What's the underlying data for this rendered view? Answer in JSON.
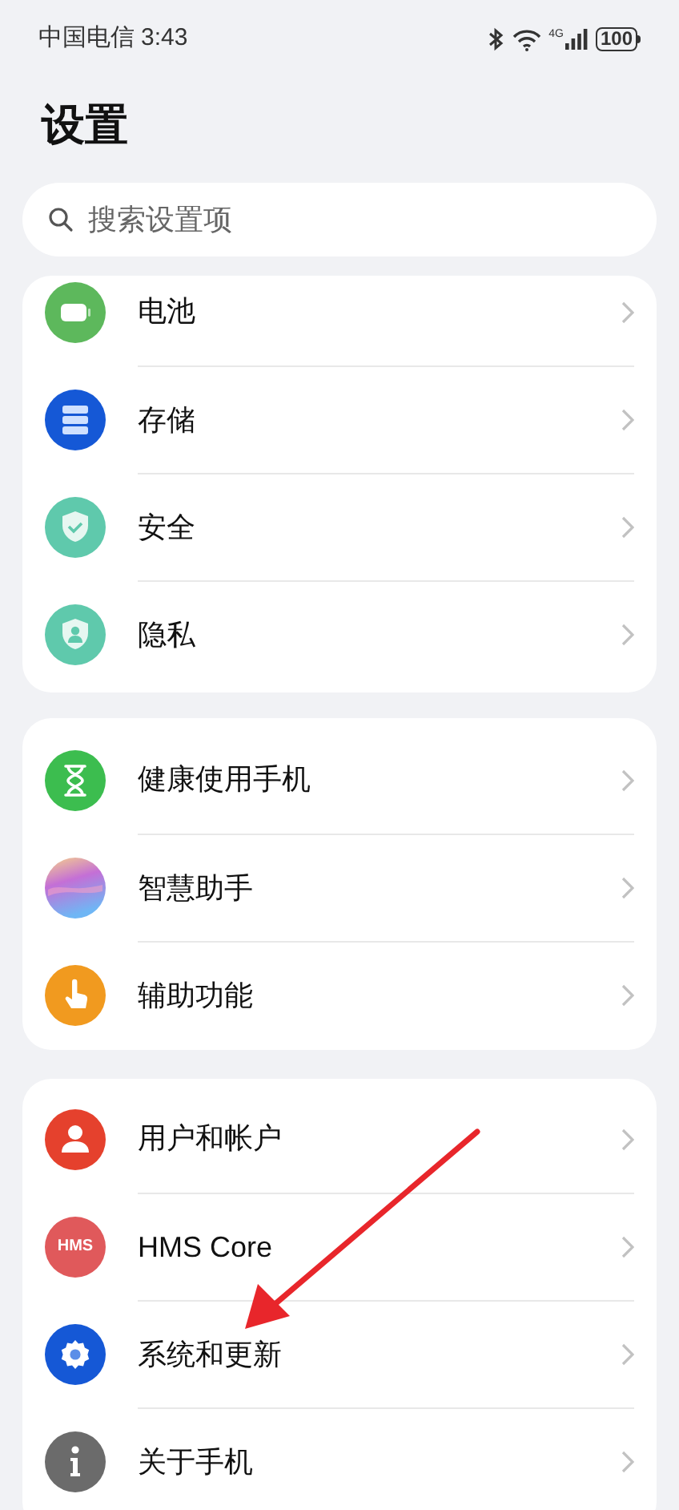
{
  "status_bar": {
    "carrier": "中国电信",
    "time": "3:43",
    "network": "4G",
    "battery": "100"
  },
  "title": "设置",
  "search": {
    "placeholder": "搜索设置项"
  },
  "groups": [
    {
      "items": [
        {
          "label": "电池",
          "kind": "battery"
        },
        {
          "label": "存储",
          "kind": "storage"
        },
        {
          "label": "安全",
          "kind": "security"
        },
        {
          "label": "隐私",
          "kind": "privacy"
        }
      ]
    },
    {
      "items": [
        {
          "label": "健康使用手机",
          "kind": "hourglass"
        },
        {
          "label": "智慧助手",
          "kind": "assistant"
        },
        {
          "label": "辅助功能",
          "kind": "accessibility"
        }
      ]
    },
    {
      "items": [
        {
          "label": "用户和帐户",
          "kind": "user"
        },
        {
          "label": "HMS Core",
          "kind": "text_badge",
          "badge": "HMS"
        },
        {
          "label": "系统和更新",
          "kind": "system"
        },
        {
          "label": "关于手机",
          "kind": "info"
        }
      ]
    }
  ]
}
